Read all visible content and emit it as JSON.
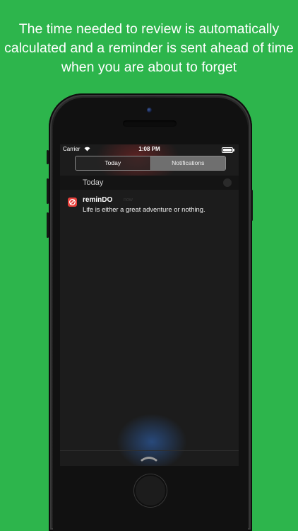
{
  "caption": {
    "line1": "The time needed to review is automatically",
    "line2": "calculated and a reminder is sent ahead of time",
    "line3": "when you are about to forget"
  },
  "status_bar": {
    "carrier": "Carrier",
    "time": "1:08 PM",
    "battery_level": 1.0
  },
  "tabs": [
    {
      "label": "Today",
      "selected": false
    },
    {
      "label": "Notifications",
      "selected": true
    }
  ],
  "section": {
    "title": "Today"
  },
  "notification": {
    "app_name": "reminDO",
    "time": "now",
    "message": "Life is either a great adventure or nothing."
  },
  "colors": {
    "background": "#2db54c",
    "app_icon": "#e8413c"
  },
  "icons": {
    "wifi": "wifi-icon",
    "app": "remindo-app-icon",
    "handle": "chevron-up-handle-icon"
  }
}
